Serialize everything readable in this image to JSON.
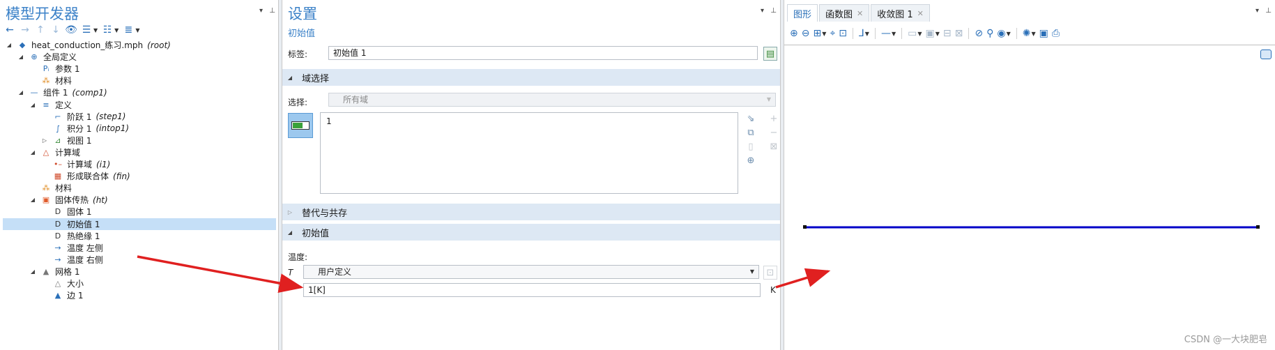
{
  "left_panel": {
    "title": "模型开发器",
    "tree": [
      {
        "label": "heat_conduction_练习.mph",
        "tag": "(root)",
        "icon": "model-file-icon",
        "twisty": "expanded"
      },
      {
        "label": "全局定义",
        "tag": "",
        "icon": "globe-icon",
        "twisty": "expanded"
      },
      {
        "label": "参数 1",
        "tag": "",
        "icon": "parameters-icon",
        "twisty": ""
      },
      {
        "label": "材料",
        "tag": "",
        "icon": "materials-icon",
        "twisty": ""
      },
      {
        "label": "组件 1",
        "tag": "(comp1)",
        "icon": "component-icon",
        "twisty": "expanded"
      },
      {
        "label": "定义",
        "tag": "",
        "icon": "definitions-icon",
        "twisty": "expanded"
      },
      {
        "label": "阶跃 1",
        "tag": "(step1)",
        "icon": "step-function-icon",
        "twisty": ""
      },
      {
        "label": "积分 1",
        "tag": "(intop1)",
        "icon": "integration-icon",
        "twisty": ""
      },
      {
        "label": "视图 1",
        "tag": "",
        "icon": "view-icon",
        "twisty": "collapsed"
      },
      {
        "label": "计算域",
        "tag": "",
        "icon": "geometry-icon",
        "twisty": "expanded"
      },
      {
        "label": "计算域",
        "tag": "(i1)",
        "icon": "interval-icon",
        "twisty": ""
      },
      {
        "label": "形成联合体",
        "tag": "(fin)",
        "icon": "form-union-icon",
        "twisty": ""
      },
      {
        "label": "材料",
        "tag": "",
        "icon": "materials-icon",
        "twisty": ""
      },
      {
        "label": "固体传热",
        "tag": "(ht)",
        "icon": "heat-transfer-icon",
        "twisty": "expanded"
      },
      {
        "label": "固体 1",
        "tag": "",
        "icon": "domain-feature-icon",
        "twisty": ""
      },
      {
        "label": "初始值 1",
        "tag": "",
        "icon": "initial-values-icon",
        "twisty": "",
        "selected": true
      },
      {
        "label": "热绝缘 1",
        "tag": "",
        "icon": "boundary-feature-icon",
        "twisty": ""
      },
      {
        "label": "温度 左侧",
        "tag": "",
        "icon": "boundary-temperature-icon",
        "twisty": ""
      },
      {
        "label": "温度 右侧",
        "tag": "",
        "icon": "boundary-temperature-icon",
        "twisty": ""
      },
      {
        "label": "网格 1",
        "tag": "",
        "icon": "mesh-icon",
        "twisty": "expanded"
      },
      {
        "label": "大小",
        "tag": "",
        "icon": "mesh-size-icon",
        "twisty": ""
      },
      {
        "label": "边 1",
        "tag": "",
        "icon": "mesh-edge-icon",
        "twisty": ""
      }
    ]
  },
  "settings": {
    "title": "设置",
    "subtitle": "初始值",
    "label_caption": "标签:",
    "label_value": "初始值 1",
    "domain_section": "域选择",
    "selection_caption": "选择:",
    "selection_value": "所有域",
    "selection_list_item": "1",
    "override_section": "替代与共存",
    "initial_section": "初始值",
    "temperature_caption": "温度:",
    "T_symbol": "T",
    "temperature_mode": "用户定义",
    "temperature_value": "1[K]",
    "temperature_unit": "K"
  },
  "graphics": {
    "tabs": [
      {
        "label": "图形",
        "active": true,
        "closable": false
      },
      {
        "label": "函数图",
        "active": false,
        "closable": true
      },
      {
        "label": "收敛图 1",
        "active": false,
        "closable": true
      }
    ],
    "line_color": "#0000c8",
    "watermark": "CSDN @一大块肥皂"
  },
  "colors": {
    "accent": "#3c82c8",
    "annotation_arrow": "#e02020",
    "selection": "#c5dff7"
  }
}
